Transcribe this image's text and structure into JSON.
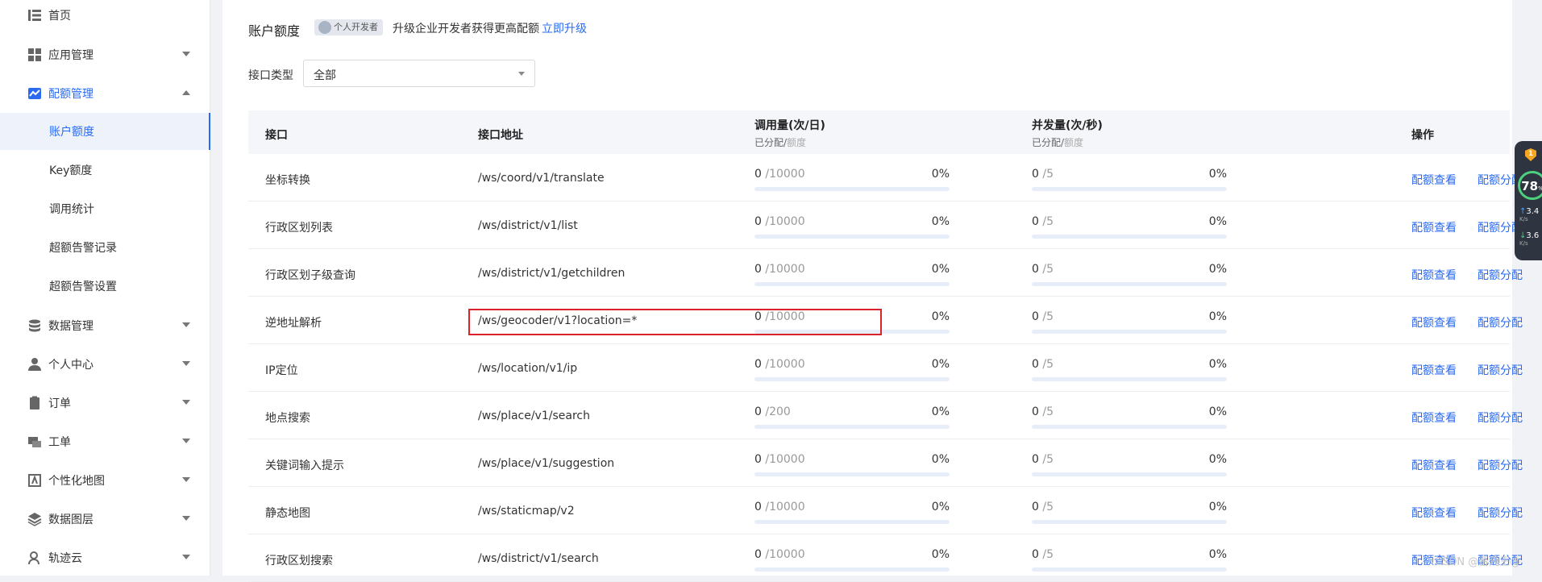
{
  "sidebar": {
    "items": [
      {
        "label": "首页",
        "icon": "list-icon",
        "expandable": false
      },
      {
        "label": "应用管理",
        "icon": "grid-icon",
        "expandable": true
      },
      {
        "label": "配额管理",
        "icon": "trend-icon",
        "expandable": true,
        "expanded": true
      },
      {
        "label": "数据管理",
        "icon": "database-icon",
        "expandable": true
      },
      {
        "label": "个人中心",
        "icon": "user-icon",
        "expandable": true
      },
      {
        "label": "订单",
        "icon": "clipboard-icon",
        "expandable": true
      },
      {
        "label": "工单",
        "icon": "ticket-icon",
        "expandable": true
      },
      {
        "label": "个性化地图",
        "icon": "map-icon",
        "expandable": true
      },
      {
        "label": "数据图层",
        "icon": "layers-icon",
        "expandable": true
      },
      {
        "label": "轨迹云",
        "icon": "location-user-icon",
        "expandable": true
      }
    ],
    "sub_items": [
      {
        "label": "账户额度",
        "selected": true
      },
      {
        "label": "Key额度"
      },
      {
        "label": "调用统计"
      },
      {
        "label": "超额告警记录"
      },
      {
        "label": "超额告警设置"
      }
    ]
  },
  "header": {
    "title": "账户额度",
    "badge": "个人开发者",
    "upgrade_text": "升级企业开发者获得更高配额",
    "upgrade_link": "立即升级"
  },
  "filter": {
    "label": "接口类型",
    "value": "全部"
  },
  "table": {
    "columns": {
      "api": "接口",
      "path": "接口地址",
      "calls": "调用量(次/日)",
      "calls_sub_a": "已分配/",
      "calls_sub_b": "额度",
      "concurrency": "并发量(次/秒)",
      "conc_sub_a": "已分配/",
      "conc_sub_b": "额度",
      "actions": "操作"
    },
    "rows": [
      {
        "api": "坐标转换",
        "path": "/ws/coord/v1/translate",
        "calls_used": "0",
        "calls_total": " /10000",
        "calls_pct": "0%",
        "conc_used": "0",
        "conc_total": " /5",
        "conc_pct": "0%"
      },
      {
        "api": "行政区划列表",
        "path": "/ws/district/v1/list",
        "calls_used": "0",
        "calls_total": " /10000",
        "calls_pct": "0%",
        "conc_used": "0",
        "conc_total": " /5",
        "conc_pct": "0%"
      },
      {
        "api": "行政区划子级查询",
        "path": "/ws/district/v1/getchildren",
        "calls_used": "0",
        "calls_total": " /10000",
        "calls_pct": "0%",
        "conc_used": "0",
        "conc_total": " /5",
        "conc_pct": "0%"
      },
      {
        "api": "逆地址解析",
        "path": "/ws/geocoder/v1?location=*",
        "calls_used": "0",
        "calls_total": " /10000",
        "calls_pct": "0%",
        "conc_used": "0",
        "conc_total": " /5",
        "conc_pct": "0%"
      },
      {
        "api": "IP定位",
        "path": "/ws/location/v1/ip",
        "calls_used": "0",
        "calls_total": " /10000",
        "calls_pct": "0%",
        "conc_used": "0",
        "conc_total": " /5",
        "conc_pct": "0%"
      },
      {
        "api": "地点搜索",
        "path": "/ws/place/v1/search",
        "calls_used": "0",
        "calls_total": " /200",
        "calls_pct": "0%",
        "conc_used": "0",
        "conc_total": " /5",
        "conc_pct": "0%"
      },
      {
        "api": "关键词输入提示",
        "path": "/ws/place/v1/suggestion",
        "calls_used": "0",
        "calls_total": " /10000",
        "calls_pct": "0%",
        "conc_used": "0",
        "conc_total": " /5",
        "conc_pct": "0%"
      },
      {
        "api": "静态地图",
        "path": "/ws/staticmap/v2",
        "calls_used": "0",
        "calls_total": " /10000",
        "calls_pct": "0%",
        "conc_used": "0",
        "conc_total": " /5",
        "conc_pct": "0%"
      },
      {
        "api": "行政区划搜索",
        "path": "/ws/district/v1/search",
        "calls_used": "0",
        "calls_total": " /10000",
        "calls_pct": "0%",
        "conc_used": "0",
        "conc_total": " /5",
        "conc_pct": "0%"
      }
    ],
    "action_view": "配额查看",
    "action_assign": "配额分配"
  },
  "widget": {
    "alert_count": "1",
    "score": "78",
    "score_unit": "%",
    "upload": "3.4",
    "download": "3.6",
    "speed_unit": "K/s"
  },
  "watermark": "CSDN @晋凡王@",
  "colors": {
    "accent": "#2a6af0",
    "highlight_border": "#d9222a"
  }
}
